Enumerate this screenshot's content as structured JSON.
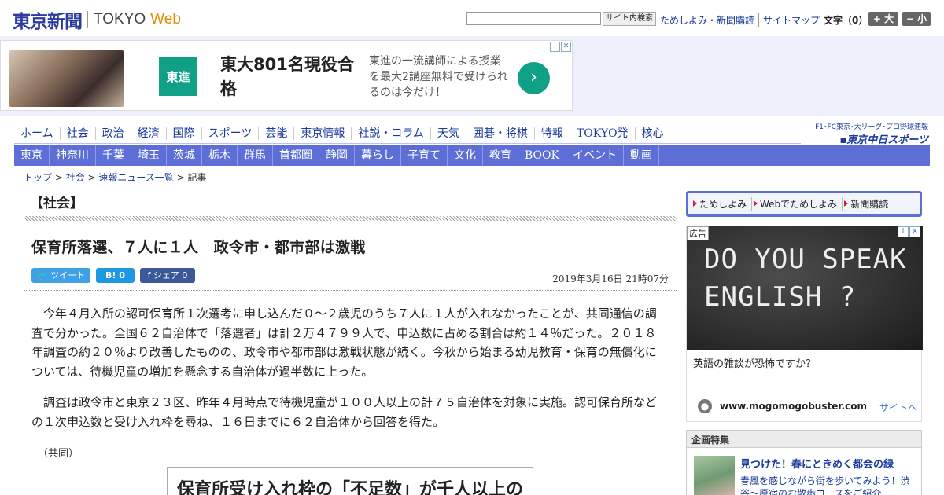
{
  "header": {
    "logo_kanji": "東京新聞",
    "logo_tokyo": "TOKYO",
    "logo_web": "Web",
    "search_button": "サイト内検索",
    "links": [
      "ためしよみ・新聞購読",
      "サイトマップ"
    ],
    "font_label": "文字（0）",
    "font_large": "+ 大",
    "font_small": "− 小"
  },
  "top_ad": {
    "logo_text": "東進",
    "headline": "東大801名現役合格",
    "body": "東進の一流講師による授業を最大2講座無料で受けられるのは今だけ！",
    "arrow": "›",
    "choice_icons": [
      "i",
      "✕"
    ]
  },
  "nav_primary": [
    "ホーム",
    "社会",
    "政治",
    "経済",
    "国際",
    "スポーツ",
    "芸能",
    "東京情報",
    "社説・コラム",
    "天気",
    "囲碁・将棋",
    "特報",
    "TOKYO発",
    "核心"
  ],
  "nav_secondary": [
    "東京",
    "神奈川",
    "千葉",
    "埼玉",
    "茨城",
    "栃木",
    "群馬",
    "首都圏",
    "静岡",
    "暮らし",
    "子育て",
    "文化",
    "教育",
    "BOOK",
    "イベント",
    "動画"
  ],
  "sports_logo": {
    "top": "F1･FC東京･大リーグ･プロ野球速報",
    "bottom": "▪東京中日スポーツ"
  },
  "breadcrumb": {
    "items": [
      "トップ",
      "社会",
      "速報ニュース一覧"
    ],
    "separator": " > ",
    "current": "記事"
  },
  "article": {
    "section": "【社会】",
    "title": "保育所落選、７人に１人　政令市・都市部は激戦",
    "share": {
      "tweet": "ツイート",
      "hatena": "B! 0",
      "facebook": "f シェア 0"
    },
    "date": "2019年3月16日 21時07分",
    "paragraphs": [
      "今年４月入所の認可保育所１次選考に申し込んだ０～２歳児のうち７人に１人が入れなかったことが、共同通信の調査で分かった。全国６２自治体で「落選者」は計２万４７９９人で、申込数に占める割合は約１４％だった。２０１８年調査の約２０％より改善したものの、政令市や都市部は激戦状態が続く。今秋から始まる幼児教育・保育の無償化については、待機児童の増加を懸念する自治体が過半数に上った。",
      "調査は政令市と東京２３区、昨年４月時点で待機児童が１００人以上の計７５自治体を対象に実施。認可保育所などの１次申込数と受け入れ枠を尋ね、１６日までに６２自治体から回答を得た。"
    ],
    "credit": "（共同）",
    "figure_title": "保育所受け入れ枠の「不足数」が千人以上の"
  },
  "sidebar": {
    "links": [
      "ためしよみ",
      "Webでためしよみ",
      "新聞購読"
    ],
    "ad": {
      "label": "広告",
      "image_text": "DO YOU SPEAK ENGLISH ?",
      "text": "英語の雑談が恐怖ですか？",
      "url": "www.mogomogobuster.com",
      "link": "サイトへ",
      "choice_icons": [
        "i",
        "✕"
      ]
    },
    "feature": {
      "heading": "企画特集",
      "title": "見つけた！春にときめく都会の緑",
      "desc": "春風を感じながら街を歩いてみよう！渋谷～原宿のお散歩コースをご紹介"
    }
  }
}
